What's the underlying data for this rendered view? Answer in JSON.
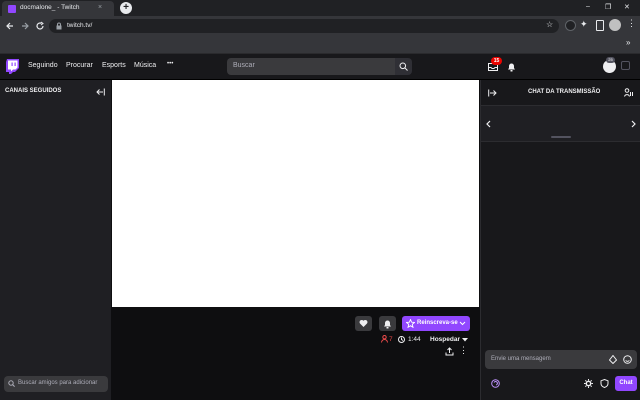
{
  "browser": {
    "tab_title": "docmalone_ - Twitch",
    "tab_close": "×",
    "new_tab": "+",
    "url": "twitch.tv/",
    "window_controls": [
      "–",
      "❐",
      "✕"
    ]
  },
  "nav": {
    "following": "Seguindo",
    "browse": "Procurar",
    "esports": "Esports",
    "music": "Música",
    "more": "•••",
    "search_placeholder": "Buscar",
    "inbox_count": "15",
    "avatar_badge": "25"
  },
  "sidebar": {
    "heading": "CANAIS SEGUIDOS",
    "friend_search_placeholder": "Buscar amigos para adicionar"
  },
  "channel": {
    "subscribe_label": "Reinscreva-se",
    "viewers": "7",
    "uptime": "1:44",
    "host_label": "Hospedar"
  },
  "chat": {
    "title": "CHAT DA TRANSMISSÃO",
    "input_placeholder": "Envie uma mensagem",
    "chat_button": "Chat"
  },
  "colors": {
    "brand": "#9147ff",
    "alert": "#eb0400",
    "viewer": "#eb4a4a"
  }
}
